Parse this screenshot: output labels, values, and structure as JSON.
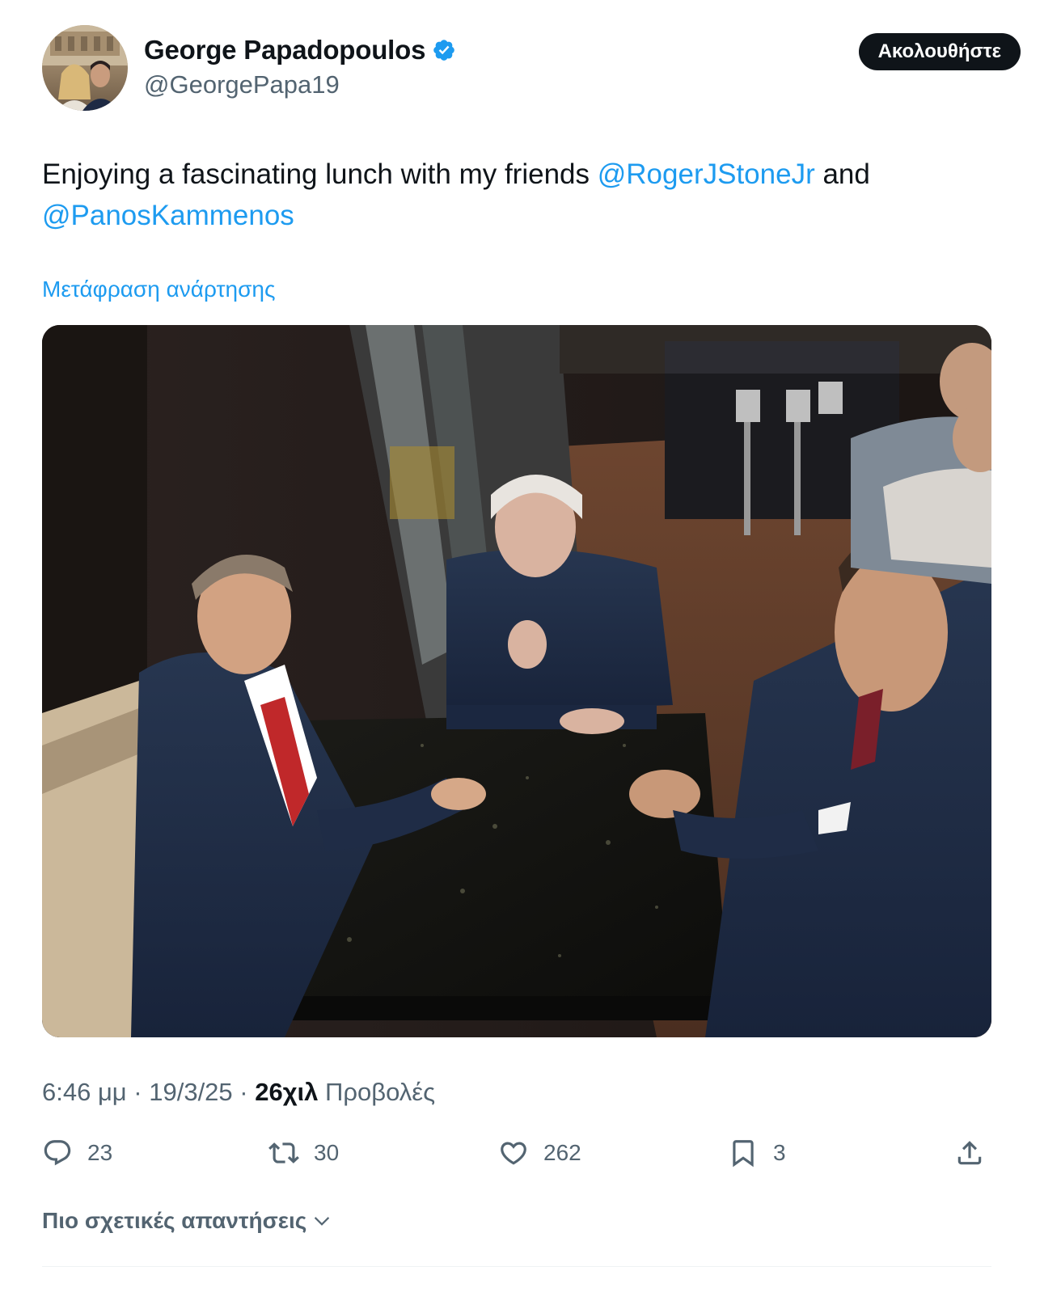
{
  "author": {
    "display_name": "George Papadopoulos",
    "handle": "@GeorgePapa19",
    "verified": true
  },
  "follow_button": {
    "label": "Ακολουθήστε"
  },
  "tweet": {
    "text_before": "Enjoying a fascinating lunch with my friends ",
    "mention_1": "@RogerJStoneJr",
    "text_middle": " and",
    "mention_2": "@PanosKammenos"
  },
  "translate_label": "Μετάφραση ανάρτησης",
  "meta": {
    "time": "6:46 μμ",
    "separator_1": " · ",
    "date": "19/3/25",
    "separator_2": " · ",
    "views_count": "26χιλ",
    "views_label": " Προβολές"
  },
  "actions": {
    "replies": "23",
    "reposts": "30",
    "likes": "262",
    "bookmarks": "3"
  },
  "replies_sort_label": "Πιο σχετικές απαντήσεις",
  "colors": {
    "accent": "#1d9bf0",
    "text": "#0f1419",
    "muted": "#536471"
  }
}
